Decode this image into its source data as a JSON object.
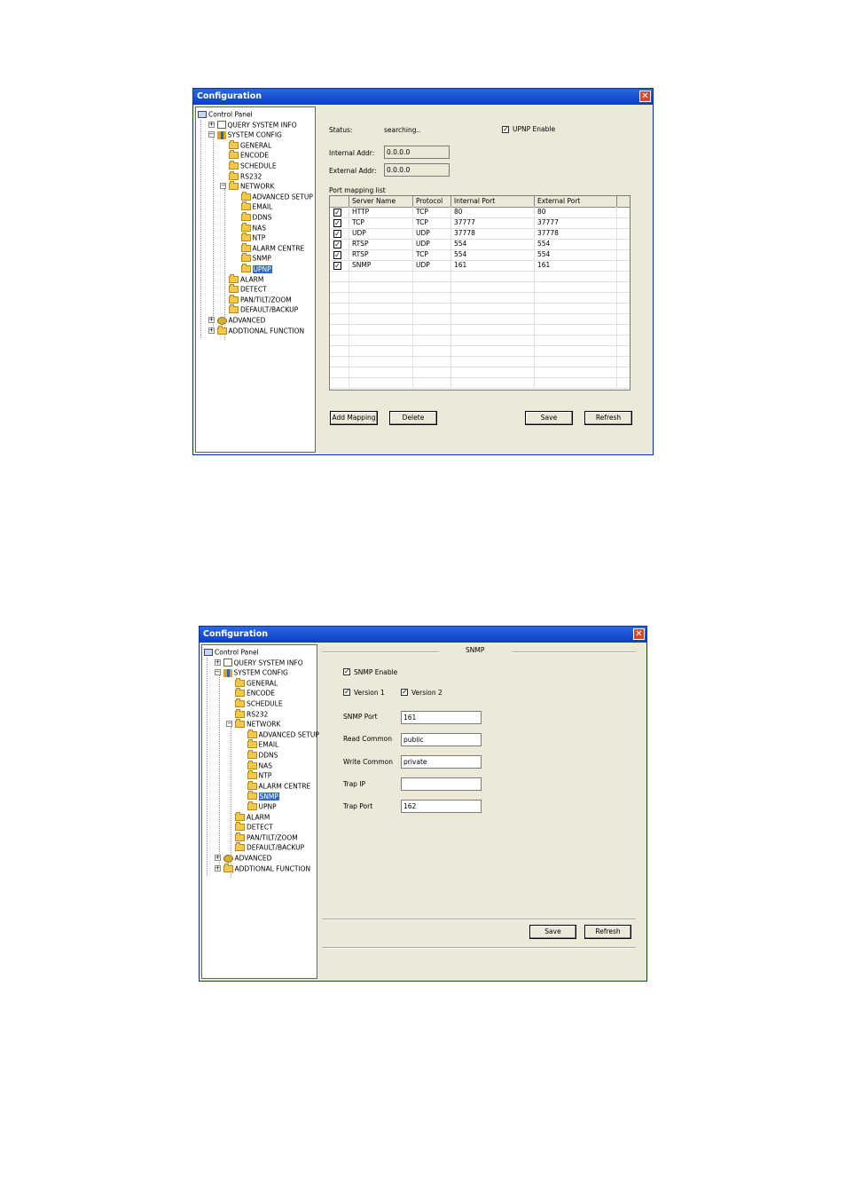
{
  "window1": {
    "title": "Configuration",
    "tree": {
      "control_panel": "Control Panel",
      "query": "QUERY SYSTEM INFO",
      "system_config": "SYSTEM CONFIG",
      "general": "GENERAL",
      "encode": "ENCODE",
      "schedule": "SCHEDULE",
      "rs232": "RS232",
      "network": "NETWORK",
      "advanced_setup": "ADVANCED SETUP",
      "email": "EMAIL",
      "ddns": "DDNS",
      "nas": "NAS",
      "ntp": "NTP",
      "alarm_centre": "ALARM CENTRE",
      "snmp": "SNMP",
      "upnp": "UPNP",
      "alarm": "ALARM",
      "detect": "DETECT",
      "ptz": "PAN/TILT/ZOOM",
      "default_backup": "DEFAULT/BACKUP",
      "advanced": "ADVANCED",
      "additional": "ADDTIONAL FUNCTION",
      "selected": "UPNP"
    },
    "status_label": "Status:",
    "status_value": "searching..",
    "upnp_enable_label": "UPNP Enable",
    "upnp_enabled": true,
    "internal_addr_label": "Internal Addr:",
    "internal_addr": "0.0.0.0",
    "external_addr_label": "External Addr:",
    "external_addr": "0.0.0.0",
    "port_list_label": "Port mapping list",
    "columns": [
      "Server Name",
      "Protocol",
      "Internal Port",
      "External Port"
    ],
    "rows": [
      {
        "checked": true,
        "name": "HTTP",
        "protocol": "TCP",
        "internal": "80",
        "external": "80"
      },
      {
        "checked": true,
        "name": "TCP",
        "protocol": "TCP",
        "internal": "37777",
        "external": "37777"
      },
      {
        "checked": true,
        "name": "UDP",
        "protocol": "UDP",
        "internal": "37778",
        "external": "37778"
      },
      {
        "checked": true,
        "name": "RTSP",
        "protocol": "UDP",
        "internal": "554",
        "external": "554"
      },
      {
        "checked": true,
        "name": "RTSP",
        "protocol": "TCP",
        "internal": "554",
        "external": "554"
      },
      {
        "checked": true,
        "name": "SNMP",
        "protocol": "UDP",
        "internal": "161",
        "external": "161"
      }
    ],
    "buttons": {
      "add": "Add Mapping",
      "delete": "Delete",
      "save": "Save",
      "refresh": "Refresh"
    }
  },
  "window2": {
    "title": "Configuration",
    "section_title": "SNMP",
    "snmp_enable_label": "SNMP Enable",
    "snmp_enabled": true,
    "version1_label": "Version 1",
    "version1": true,
    "version2_label": "Version 2",
    "version2": true,
    "snmp_port_label": "SNMP Port",
    "snmp_port": "161",
    "read_common_label": "Read Common",
    "read_common": "public",
    "write_common_label": "Write Common",
    "write_common": "private",
    "trap_ip_label": "Trap IP",
    "trap_ip": "",
    "trap_port_label": "Trap Port",
    "trap_port": "162",
    "buttons": {
      "save": "Save",
      "refresh": "Refresh"
    },
    "selected": "SNMP"
  },
  "glyphs": {
    "check": "✓",
    "close": "✕",
    "plus": "+",
    "minus": "−"
  }
}
